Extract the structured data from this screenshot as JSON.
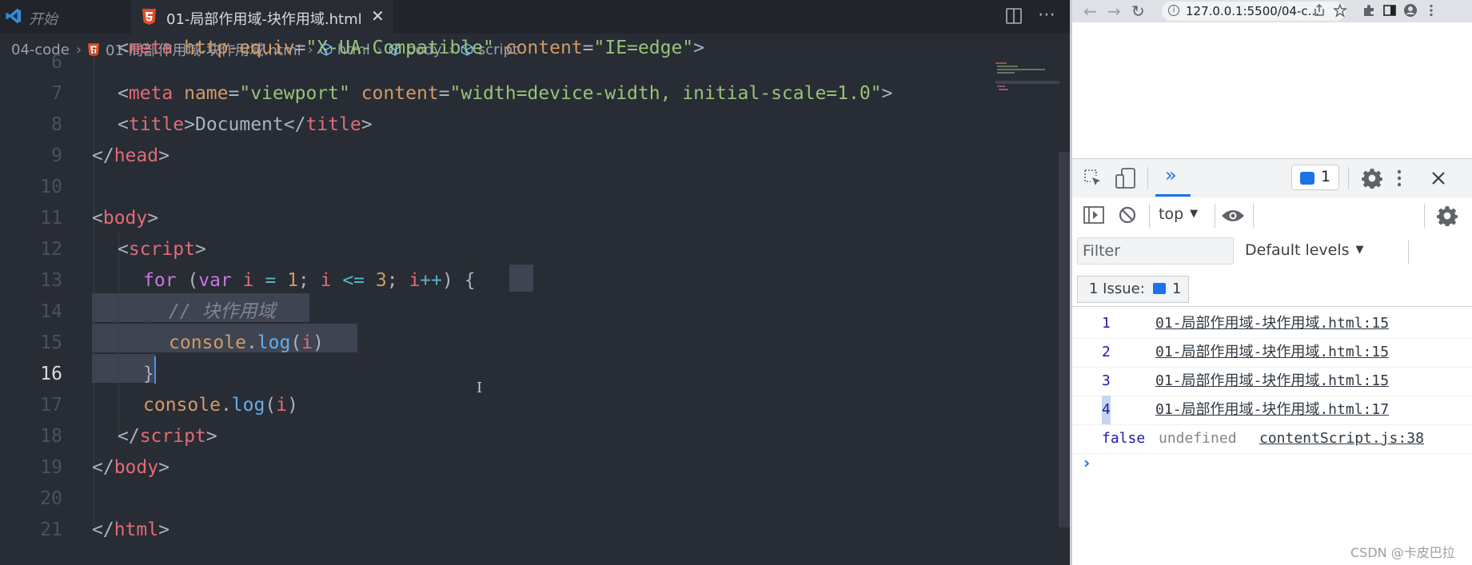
{
  "editor": {
    "tabs": {
      "start_label": "开始",
      "active_label": "01-局部作用域-块作用域.html",
      "close_glyph": "✕",
      "more_glyph": "⋯"
    },
    "breadcrumb": {
      "folder": "04-code",
      "file": "01-局部作用域-块作用域.html",
      "html": "html",
      "body": "body",
      "script": "script",
      "separator": "›"
    },
    "line_numbers": [
      "6",
      "7",
      "8",
      "9",
      "10",
      "11",
      "12",
      "13",
      "14",
      "15",
      "16",
      "17",
      "18",
      "19",
      "20",
      "21"
    ],
    "current_line": "16",
    "code": {
      "l6": {
        "lt": "<",
        "tag": "meta",
        "sp": " ",
        "attr1": "http-equiv",
        "eq": "=",
        "val1": "\"X-UA-Compatible\"",
        "attr2": "content",
        "val2": "\"IE=edge\"",
        "gt": ">"
      },
      "l7": {
        "lt": "<",
        "tag": "meta",
        "attr1": "name",
        "eq": "=",
        "val1": "\"viewport\"",
        "attr2": "content",
        "val2": "\"width=device-width, initial-scale=1.0\"",
        "gt": ">"
      },
      "l8": {
        "lt": "<",
        "tag": "title",
        "gt": ">",
        "text": "Document",
        "close": "</",
        "tag2": "title",
        "gt2": ">"
      },
      "l9": {
        "open": "</",
        "tag": "head",
        "gt": ">"
      },
      "l11": {
        "lt": "<",
        "tag": "body",
        "gt": ">"
      },
      "l12": {
        "lt": "<",
        "tag": "script",
        "gt": ">"
      },
      "l13": {
        "kw_for": "for",
        "p1": " (",
        "kw_var": "var",
        "sp": " ",
        "v1": "i",
        "eq": " = ",
        "n1": "1",
        "semi": "; ",
        "v2": "i",
        "le": " <= ",
        "n3": "3",
        "semi2": "; ",
        "v3": "i",
        "inc": "++",
        "p2": ") ",
        "brace": "{"
      },
      "l14": {
        "comment": "// 块作用域"
      },
      "l15": {
        "obj": "console",
        "dot": ".",
        "fn": "log",
        "p1": "(",
        "arg": "i",
        "p2": ")"
      },
      "l16": {
        "brace": "}"
      },
      "l17": {
        "obj": "console",
        "dot": ".",
        "fn": "log",
        "p1": "(",
        "arg": "i",
        "p2": ")"
      },
      "l18": {
        "open": "</",
        "tag": "script",
        "gt": ">"
      },
      "l19": {
        "open": "</",
        "tag": "body",
        "gt": ">"
      },
      "l21": {
        "open": "</",
        "tag": "html",
        "gt": ">"
      }
    }
  },
  "browser": {
    "nav": {
      "back": "←",
      "forward": "→",
      "reload": "↻",
      "url": "127.0.0.1:5500/04-c..."
    },
    "devtools": {
      "more_tabs": "»",
      "issues_badge_count": "1",
      "context": "top",
      "filter_placeholder": "Filter",
      "levels": "Default levels",
      "issue_label": "1 Issue:",
      "issue_count": "1",
      "console": [
        {
          "value": "1",
          "source": "01-局部作用域-块作用域.html:15"
        },
        {
          "value": "2",
          "source": "01-局部作用域-块作用域.html:15"
        },
        {
          "value": "3",
          "source": "01-局部作用域-块作用域.html:15"
        },
        {
          "value": "4",
          "source": "01-局部作用域-块作用域.html:17"
        }
      ],
      "last_row": {
        "bool": "false",
        "undef": "undefined",
        "source": "contentScript.js:38"
      },
      "prompt": "›"
    }
  },
  "watermark": "CSDN @卡皮巴拉",
  "colors": {
    "editor_bg": "#282c34",
    "tag": "#e06c75",
    "attr": "#d19a66",
    "string": "#98c379",
    "keyword": "#c678dd",
    "function": "#61afef",
    "comment": "#7f848e",
    "devtools_blue": "#1a73e8"
  }
}
